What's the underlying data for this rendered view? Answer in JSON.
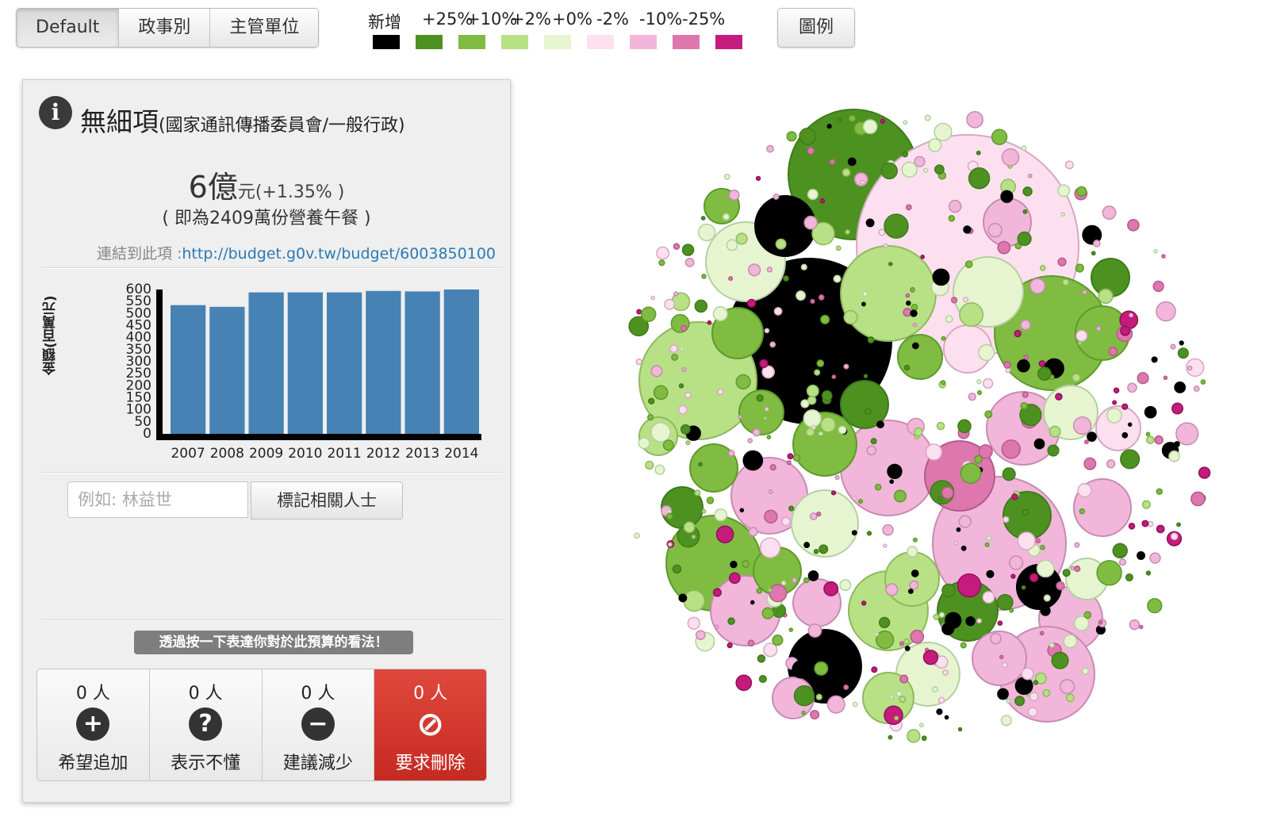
{
  "tabs": [
    {
      "label": "Default",
      "active": true
    },
    {
      "label": "政事別",
      "active": false
    },
    {
      "label": "主管單位",
      "active": false
    }
  ],
  "legend": {
    "items": [
      {
        "label": "新增",
        "color": "#000000"
      },
      {
        "label": "+25%",
        "color": "#4d9221"
      },
      {
        "label": "+10%",
        "color": "#7fbc41"
      },
      {
        "label": "+2%",
        "color": "#b8e186"
      },
      {
        "label": "+0%",
        "color": "#e6f5d0"
      },
      {
        "label": "-2%",
        "color": "#fde0ef"
      },
      {
        "label": "-10%",
        "color": "#f1b6da"
      },
      {
        "label": "-25%",
        "color": "#de77ae"
      },
      {
        "label": "",
        "color": "#c51b7d"
      }
    ],
    "button_label": "圖例"
  },
  "panel": {
    "info_icon": "info-icon",
    "title_main": "無細項",
    "title_sub": "(國家通訊傳播委員會/一般行政)",
    "amount_value": "6億",
    "amount_unit": "元(+1.35% )",
    "lunch_text": "( 即為2409萬份營養午餐 )",
    "link_label": "連結到此項 :",
    "link_url": "http://budget.g0v.tw/budget/6003850100",
    "tag_placeholder": "例如: 林益世",
    "tag_button": "標記相關人士",
    "hint": "透過按一下表達你對於此預算的看法！",
    "votes": [
      {
        "count": "0 人",
        "label": "希望追加",
        "icon": "plus-circle-icon",
        "glyph": "+"
      },
      {
        "count": "0 人",
        "label": "表示不懂",
        "icon": "question-circle-icon",
        "glyph": "?"
      },
      {
        "count": "0 人",
        "label": "建議減少",
        "icon": "minus-circle-icon",
        "glyph": "−"
      },
      {
        "count": "0 人",
        "label": "要求刪除",
        "icon": "ban-icon",
        "glyph": "⊘"
      }
    ]
  },
  "chart_data": {
    "type": "bar",
    "ylabel": "金額(百萬元)",
    "categories": [
      "2007",
      "2008",
      "2009",
      "2010",
      "2011",
      "2012",
      "2013",
      "2014"
    ],
    "values": [
      535,
      528,
      588,
      588,
      588,
      594,
      592,
      600
    ],
    "ylim": [
      0,
      600
    ],
    "yticks": [
      0,
      50,
      100,
      150,
      200,
      250,
      300,
      350,
      400,
      450,
      500,
      550,
      600
    ],
    "bar_color": "#4682b4"
  }
}
